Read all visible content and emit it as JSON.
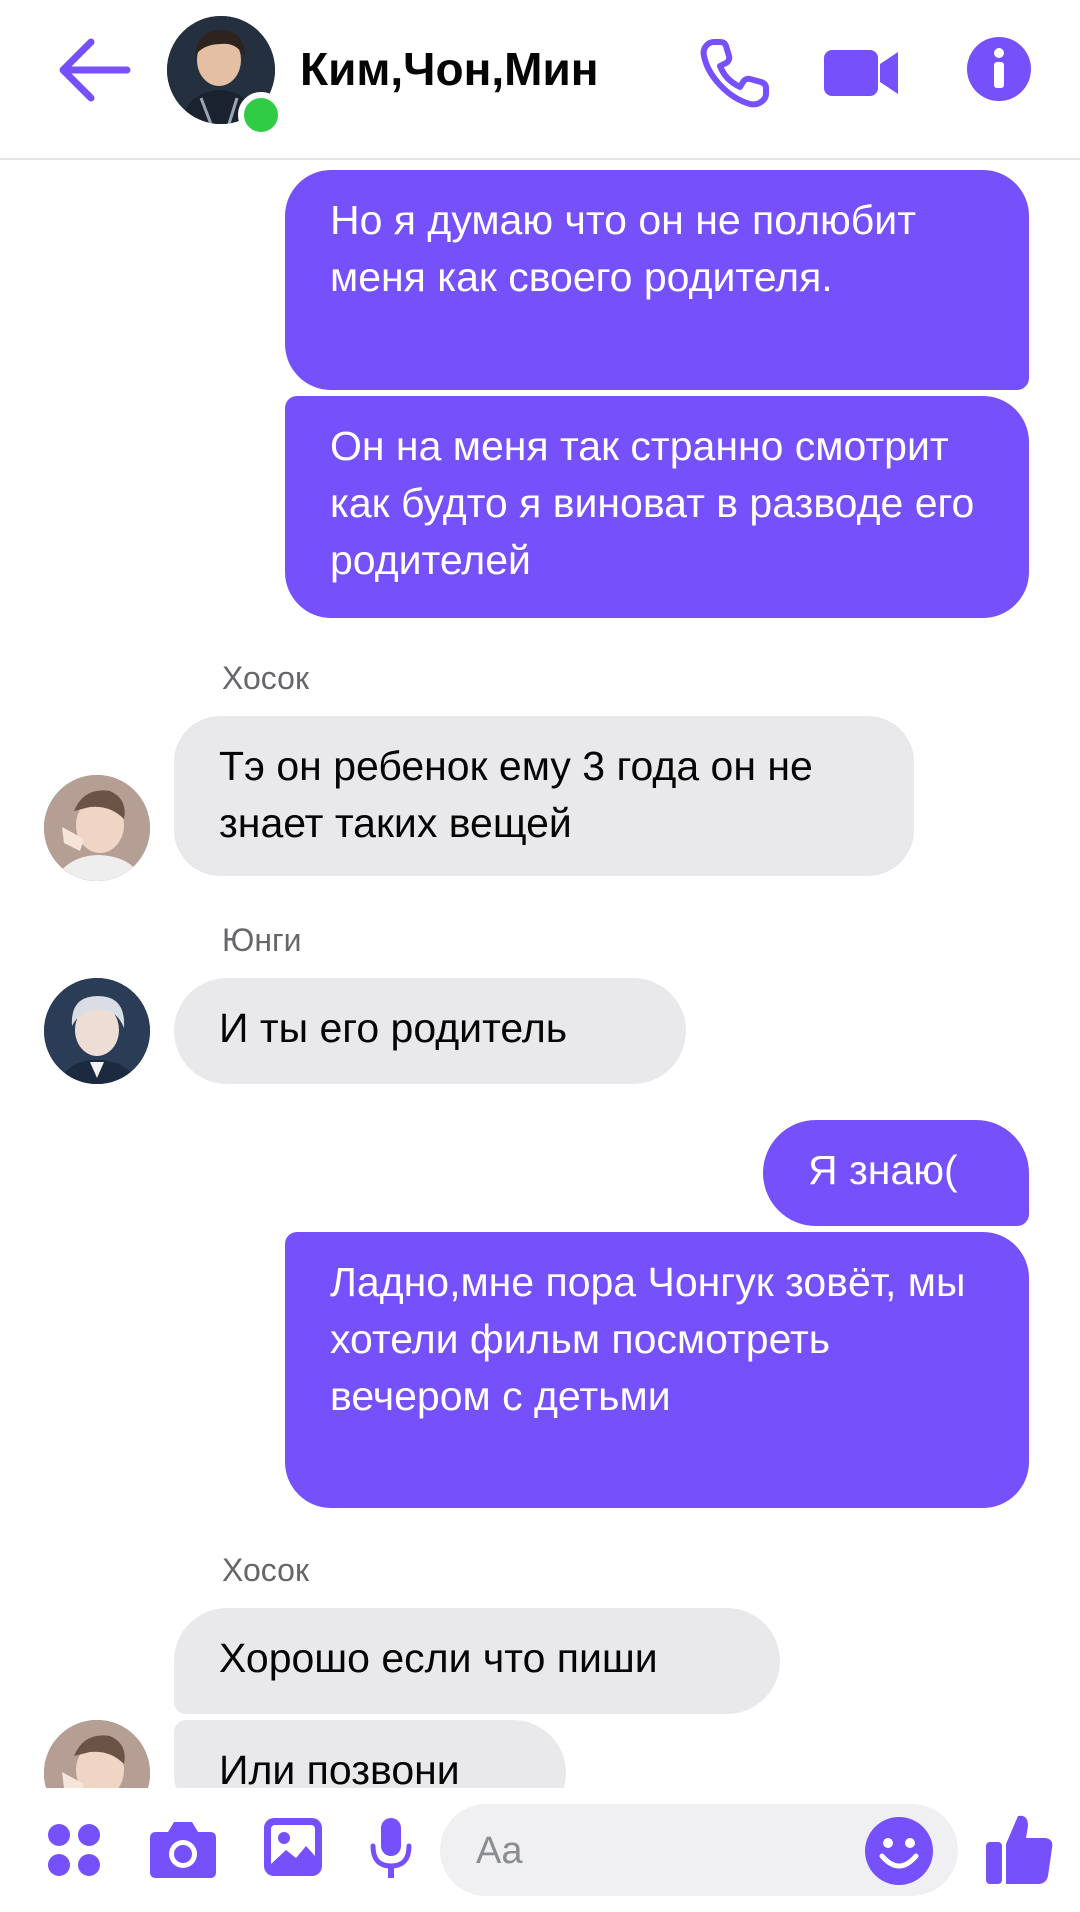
{
  "header": {
    "title": "Ким,Чон,Мин",
    "back_icon": "arrow-left-icon",
    "call_icon": "phone-icon",
    "video_icon": "video-camera-icon",
    "info_icon": "info-icon",
    "accent_color": "#7550fb",
    "online_color": "#31cc46"
  },
  "messages": {
    "m1": {
      "text": "Но я думаю что  он не полюбит  меня как своего родителя.",
      "direction": "outgoing"
    },
    "m2": {
      "text": "Он на меня так странно смотрит как будто я виноват в разводе его родителей",
      "direction": "outgoing"
    },
    "m3": {
      "sender": "Хосок",
      "text": "Тэ он ребенок ему 3 года он не знает таких вещей",
      "direction": "incoming"
    },
    "m4": {
      "sender": "Юнги",
      "text": "И ты его родитель",
      "direction": "incoming"
    },
    "m5": {
      "text": "Я знаю(",
      "direction": "outgoing"
    },
    "m6": {
      "text": "Ладно,мне пора Чонгук зовёт, мы хотели фильм посмотреть вечером с детьми",
      "direction": "outgoing"
    },
    "m7": {
      "sender": "Хосок",
      "text": "Хорошо если что пиши",
      "direction": "incoming"
    },
    "m8": {
      "text": "Или позвони",
      "direction": "incoming"
    }
  },
  "composer": {
    "placeholder": "Aa",
    "apps_icon": "four-dots-menu-icon",
    "camera_icon": "camera-icon",
    "gallery_icon": "image-gallery-icon",
    "mic_icon": "microphone-icon",
    "emoji_icon": "smiley-emoji-icon",
    "like_icon": "thumbs-up-icon"
  },
  "colors": {
    "outgoing_bubble": "#7550fb",
    "incoming_bubble": "#e9e8eb"
  }
}
